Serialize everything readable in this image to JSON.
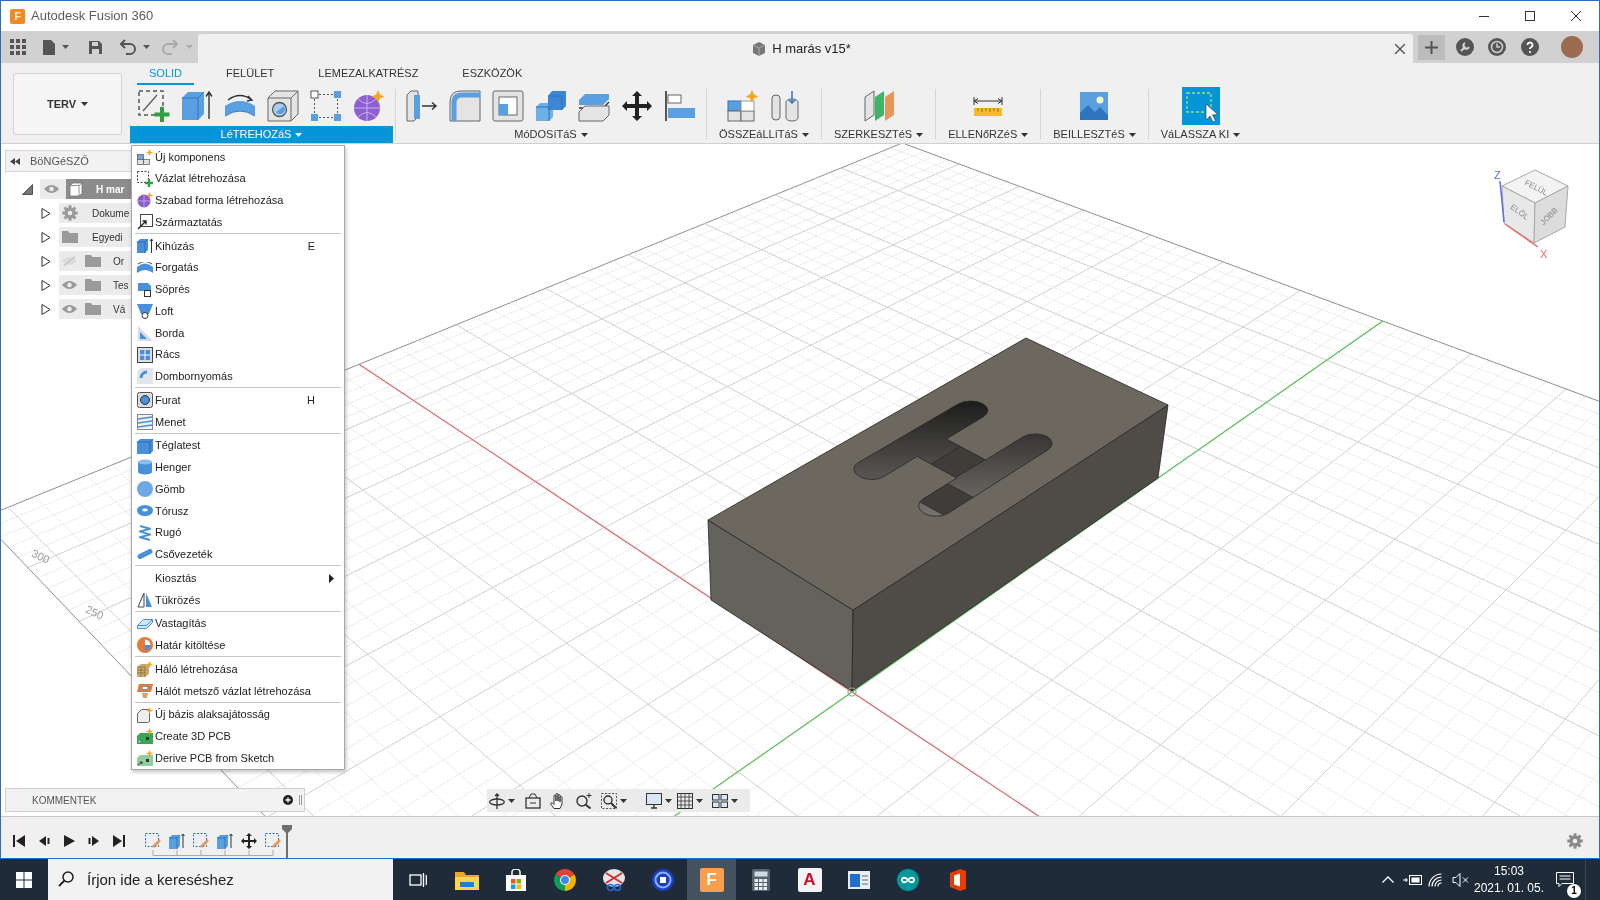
{
  "window": {
    "logo": "F",
    "title": "Autodesk Fusion 360"
  },
  "document_tab": {
    "title": "H marás v15*"
  },
  "workspace": {
    "label": "TERV"
  },
  "toolbar_tabs": [
    {
      "label": "SOLID",
      "selected": true
    },
    {
      "label": "FELÜLET",
      "selected": false
    },
    {
      "label": "LEMEZALKATRÉSZ",
      "selected": false
    },
    {
      "label": "ESZKÖZÖK",
      "selected": false
    }
  ],
  "toolbar_groups": [
    {
      "label": "LéTREHOZáS",
      "open": true
    },
    {
      "label": "MóDOSíTáS",
      "open": false
    },
    {
      "label": "ÖSSZEáLLíTáS",
      "open": false
    },
    {
      "label": "SZERKESZTéS",
      "open": false
    },
    {
      "label": "ELLENőRZéS",
      "open": false
    },
    {
      "label": "BEILLESZTéS",
      "open": false
    },
    {
      "label": "VáLASSZA KI",
      "open": false
    }
  ],
  "browser": {
    "title": "BöNGéSZŐ",
    "tree": [
      {
        "label": "H mar",
        "kind": "component",
        "expanded": true,
        "visible": true,
        "children": [
          {
            "label": "Dokume",
            "kind": "settings",
            "expanded": false
          },
          {
            "label": "Egyedi",
            "kind": "folder",
            "expanded": false
          },
          {
            "label": "Or",
            "kind": "folder",
            "expanded": false,
            "visible": false
          },
          {
            "label": "Tes",
            "kind": "folder",
            "expanded": false,
            "visible": true
          },
          {
            "label": "Vá",
            "kind": "folder",
            "expanded": false,
            "visible": true
          }
        ]
      }
    ]
  },
  "create_menu": {
    "sections": [
      {
        "items": [
          {
            "label": "Új komponens"
          },
          {
            "label": "Vázlat létrehozása"
          },
          {
            "label": "Szabad forma létrehozása"
          },
          {
            "label": "Származtatás"
          }
        ]
      },
      {
        "items": [
          {
            "label": "Kihúzás",
            "shortcut": "E"
          },
          {
            "label": "Forgatás"
          },
          {
            "label": "Söprés"
          },
          {
            "label": "Loft"
          },
          {
            "label": "Borda"
          },
          {
            "label": "Rács"
          },
          {
            "label": "Dombornyomás"
          }
        ]
      },
      {
        "items": [
          {
            "label": "Furat",
            "shortcut": "H"
          },
          {
            "label": "Menet"
          }
        ]
      },
      {
        "items": [
          {
            "label": "Téglatest"
          },
          {
            "label": "Henger"
          },
          {
            "label": "Gömb"
          },
          {
            "label": "Tórusz"
          },
          {
            "label": "Rugó"
          },
          {
            "label": "Csővezeték"
          }
        ]
      },
      {
        "items": [
          {
            "label": "Kiosztás",
            "submenu": true
          },
          {
            "label": "Tükrözés"
          }
        ]
      },
      {
        "items": [
          {
            "label": "Vastagítás"
          },
          {
            "label": "Határ kitöltése"
          }
        ]
      },
      {
        "items": [
          {
            "label": "Háló létrehozása"
          },
          {
            "label": "Hálót metsző vázlat létrehozása"
          }
        ]
      },
      {
        "items": [
          {
            "label": "Új bázis alaksajátosság"
          },
          {
            "label": "Create 3D PCB"
          },
          {
            "label": "Derive PCB from Sketch"
          }
        ]
      }
    ]
  },
  "viewport": {
    "grid_labels": [
      "300",
      "250"
    ],
    "view_cube": {
      "faces": [
        "FELÜL",
        "ELÖL",
        "JOBB"
      ],
      "axes": [
        "Z",
        "X"
      ]
    }
  },
  "comments_panel": {
    "title": "KOMMENTEK"
  },
  "taskbar": {
    "search": {
      "placeholder": "Írjon ide a kereséshez"
    },
    "apps": [
      {
        "selected": false
      },
      {
        "selected": false
      },
      {
        "selected": false
      },
      {
        "selected": false
      },
      {
        "selected": false
      },
      {
        "glyph": "F",
        "selected": true
      },
      {
        "selected": false
      },
      {
        "glyph": "A",
        "selected": false
      },
      {
        "selected": false
      },
      {
        "selected": false
      },
      {
        "selected": false
      }
    ],
    "clock": {
      "time": "15:03",
      "date": "2021. 01. 05."
    },
    "notifications": {
      "count": "1"
    }
  }
}
